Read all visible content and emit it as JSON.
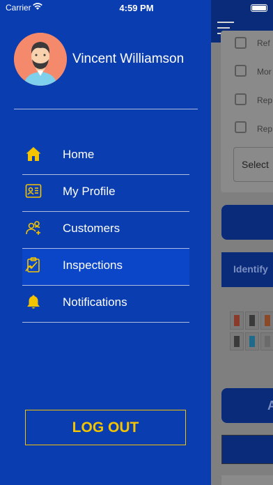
{
  "status_bar": {
    "carrier": "Carrier",
    "time": "4:59 PM"
  },
  "drawer": {
    "user_name": "Vincent Williamson",
    "menu_items": [
      {
        "label": "Home",
        "icon": "home-icon",
        "active": false
      },
      {
        "label": "My Profile",
        "icon": "profile-card-icon",
        "active": false
      },
      {
        "label": "Customers",
        "icon": "customers-icon",
        "active": false
      },
      {
        "label": "Inspections",
        "icon": "inspections-icon",
        "active": true
      },
      {
        "label": "Notifications",
        "icon": "bell-icon",
        "active": false
      }
    ],
    "logout_label": "LOG OUT"
  },
  "background_page": {
    "checkbox_labels": [
      "Ref",
      "Mor",
      "Rep",
      "Rep"
    ],
    "select_label": "Select",
    "section_label": "Identify",
    "button_label": "A"
  },
  "colors": {
    "drawer_bg": "#0a3db0",
    "active_item_bg": "#0c46c8",
    "accent_yellow": "#f4c400",
    "avatar_bg": "#f4896b"
  }
}
